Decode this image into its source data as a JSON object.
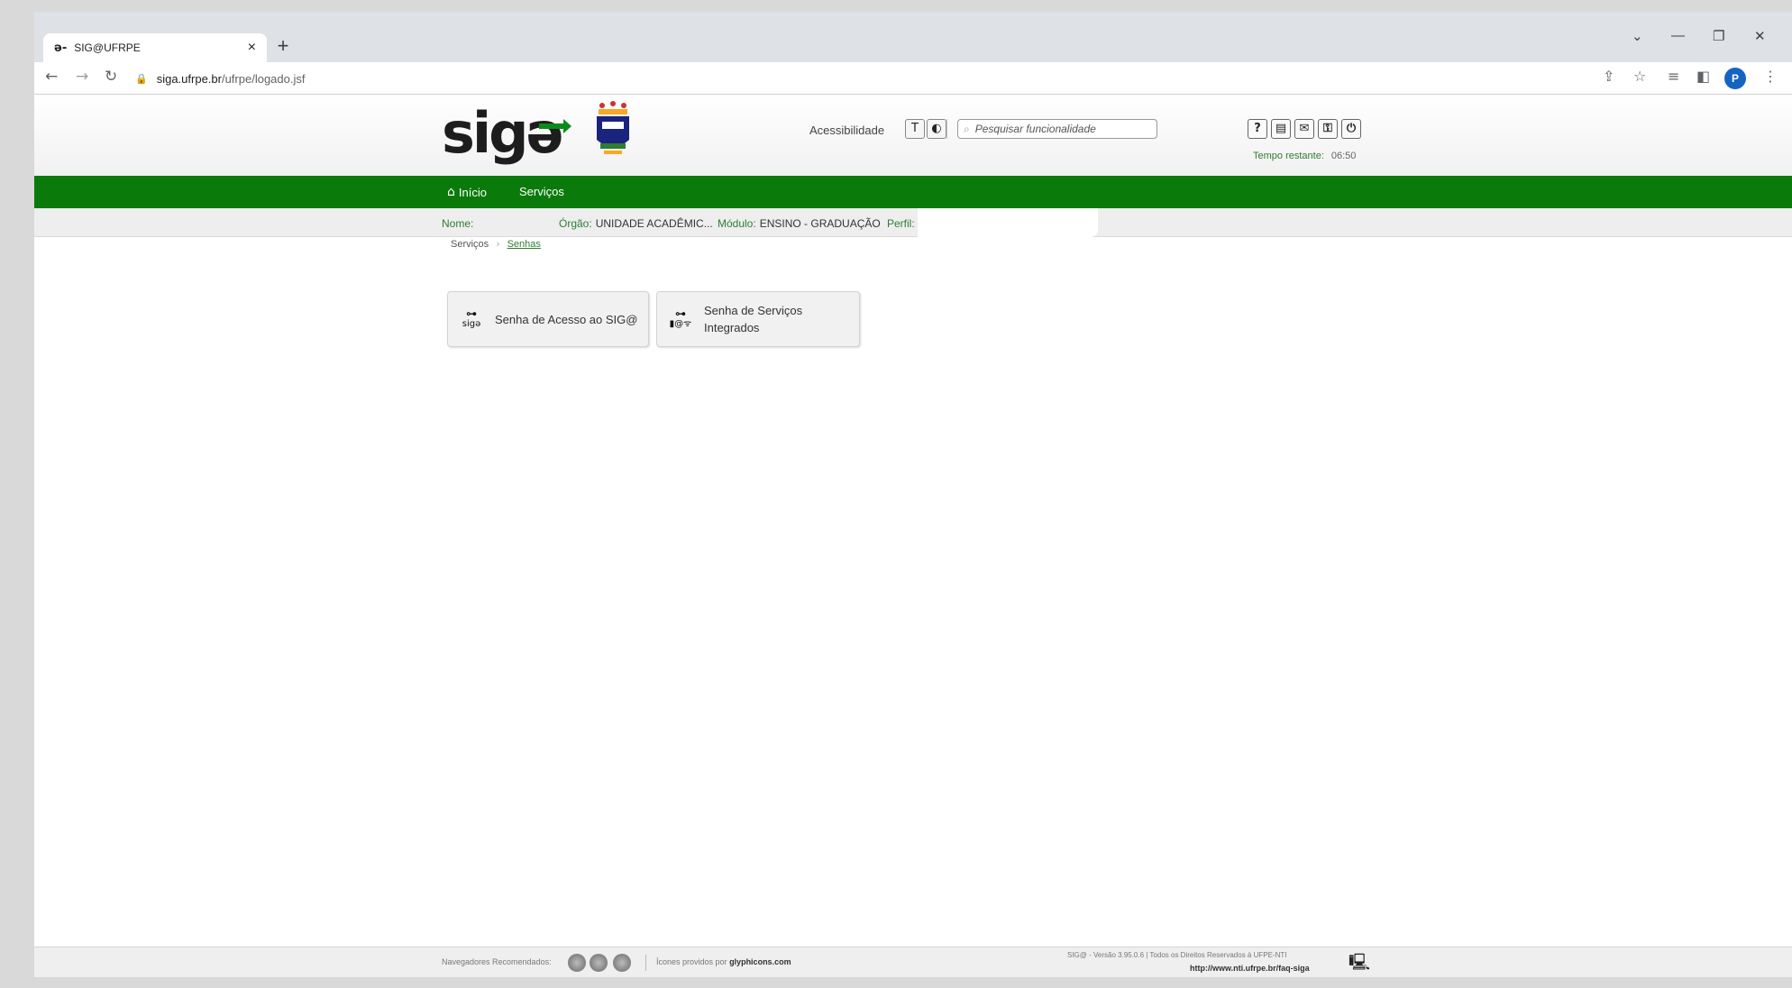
{
  "browser": {
    "tab_title": "SIG@UFRPE",
    "favicon": "ə-",
    "url_host": "siga.ufrpe.br",
    "url_path": "/ufrpe/logado.jsf",
    "profile_initial": "P"
  },
  "header": {
    "logo_text": "sig",
    "logo_tail": "ə",
    "accessibility_label": "Acessibilidade",
    "search_placeholder": "Pesquisar funcionalidade",
    "time_label": "Tempo restante:",
    "time_value": "06:50"
  },
  "nav": {
    "home_label": "Início",
    "services_label": "Serviços"
  },
  "info": {
    "nome_label": "Nome:",
    "nome_value": "",
    "orgao_label": "Órgão:",
    "orgao_value": "UNIDADE ACADÊMIC...",
    "modulo_label": "Módulo:",
    "modulo_value": "ENSINO - GRADUAÇÃO",
    "perfil_label": "Perfil:",
    "perfil_value": ""
  },
  "breadcrumb": {
    "root": "Serviços",
    "current": "Senhas"
  },
  "cards": [
    {
      "icon_top": "⊶",
      "icon_bottom": "sigə",
      "label": "Senha de Acesso ao SIG@"
    },
    {
      "icon_top": "⊶",
      "icon_bottom": "▮@ᯤ",
      "label": "Senha de Serviços Integrados"
    }
  ],
  "footer": {
    "recommended_label": "Navegadores Recomendados:",
    "icons_credit_prefix": "Ícones providos por",
    "icons_credit_site": "glyphicons.com",
    "version_text": "SIG@ - Versão 3.95.0.6 | Todos os Direitos Reservados à UFPE-NTI",
    "faq_url": "http://www.nti.ufrpe.br/faq-siga"
  },
  "colors": {
    "green_bar": "#0a7a0a",
    "label_green": "#2e7d32",
    "logo_arrow": "#0a8a1a"
  }
}
